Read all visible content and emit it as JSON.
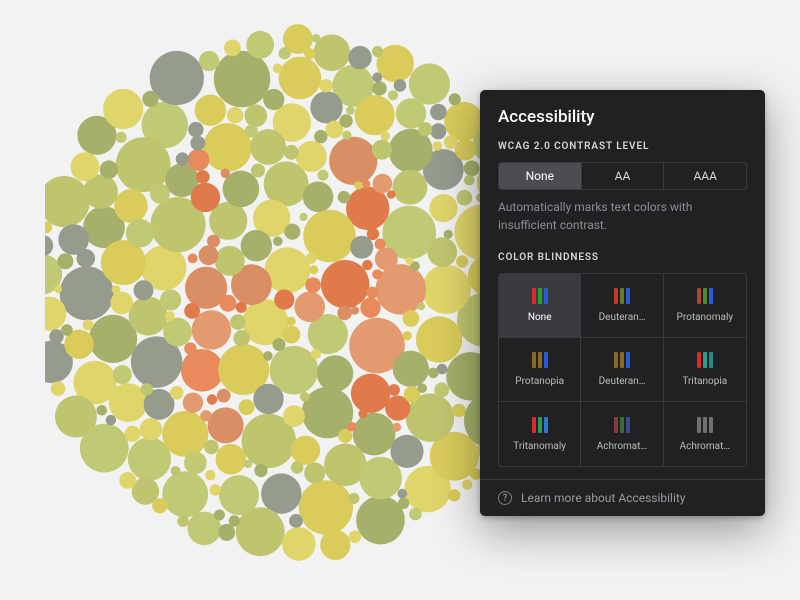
{
  "panel": {
    "title": "Accessibility",
    "contrast_section_label": "WCAG 2.0 CONTRAST LEVEL",
    "contrast_options": [
      "None",
      "AA",
      "AAA"
    ],
    "contrast_selected_index": 0,
    "contrast_description": "Automatically marks text colors with insufficient contrast.",
    "colorblind_section_label": "COLOR BLINDNESS",
    "colorblind_selected_index": 0,
    "colorblind_options": [
      {
        "label": "None",
        "bars": [
          "#d92b2b",
          "#2aa02a",
          "#2a5bd9"
        ]
      },
      {
        "label": "Deuteran…",
        "bars": [
          "#c23a2b",
          "#6a7a2a",
          "#2a5bd9"
        ]
      },
      {
        "label": "Protanomaly",
        "bars": [
          "#a54a2b",
          "#4f8a2a",
          "#2a5bd9"
        ]
      },
      {
        "label": "Protanopia",
        "bars": [
          "#8a6a2a",
          "#8a6a2a",
          "#2a5bd9"
        ]
      },
      {
        "label": "Deuteran…",
        "bars": [
          "#8a6a2a",
          "#8a6a2a",
          "#2a5bd9"
        ]
      },
      {
        "label": "Tritanopia",
        "bars": [
          "#d92b2b",
          "#2aa08a",
          "#2a8a8a"
        ]
      },
      {
        "label": "Tritanomaly",
        "bars": [
          "#d92b2b",
          "#2a9a5a",
          "#2a7acf"
        ]
      },
      {
        "label": "Achromat…",
        "bars": [
          "#8a3a3a",
          "#3a6a3a",
          "#3a4a8a"
        ]
      },
      {
        "label": "Achromat…",
        "bars": [
          "#707070",
          "#707070",
          "#707070"
        ]
      }
    ],
    "footer_label": "Learn more about Accessibility"
  },
  "plate": {
    "description": "Ishihara-style color vision test plate showing the letter H in orange dots on a background of yellow, green and grey dots",
    "letter": "H",
    "bg_colors": [
      "#e0d56b",
      "#c1c974",
      "#a6b06b",
      "#959c8e",
      "#d9cc5b",
      "#bfc56f"
    ],
    "fg_colors": [
      "#e88a5c",
      "#e07a4a",
      "#d98f63",
      "#e29a6e"
    ]
  }
}
